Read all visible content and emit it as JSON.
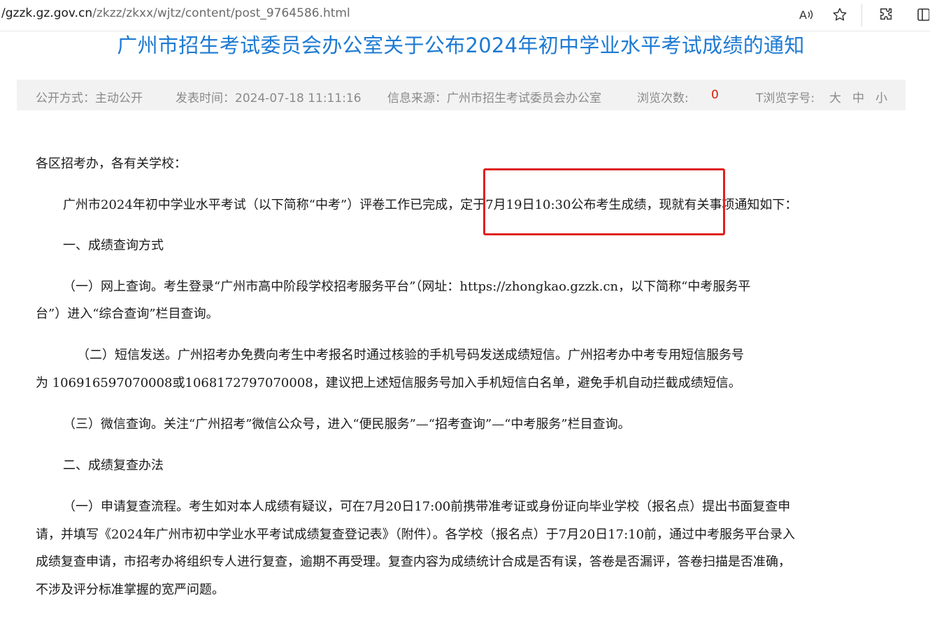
{
  "browser": {
    "url_host": "/gzzk.gz.gov.cn",
    "url_path": "/zkzz/zkxx/wjtz/content/post_9764586.html"
  },
  "article": {
    "title": "广州市招生考试委员会办公室关于公布2024年初中学业水平考试成绩的通知",
    "meta": {
      "disclosure": "公开方式：主动公开",
      "publish_time": "发表时间：2024-07-18 11:11:16",
      "source": "信息来源：广州市招生考试委员会办公室",
      "views_label": "浏览次数:",
      "views_count": "0",
      "font_size_label": "T浏览字号:",
      "size_large": "大",
      "size_medium": "中",
      "size_small": "小"
    },
    "paragraphs": {
      "p1": "各区招考办，各有关学校：",
      "p2": "广州市2024年初中学业水平考试（以下简称“中考”）评卷工作已完成，定于7月19日10:30公布考生成绩，现就有关事项通知如下：",
      "p3": "一、成绩查询方式",
      "p4a": "（一）网上查询。考生登录“广州市高中阶段学校招考服务平台”（网址：https://zhongkao.gzzk.cn，以下简称“中考服务平",
      "p4b": "台”）进入“综合查询”栏目查询。",
      "p5a": "（二）短信发送。广州招考办免费向考生中考报名时通过核验的手机号码发送成绩短信。广州招考办中考专用短信服务号",
      "p5b": "为  106916597070008或106817279707000​8，建议把上述短信服务号加入手机短信白名单，避免手机自动拦截成绩短信。",
      "p6": "（三）微信查询。关注“广州招考”微信公众号，进入“便民服务”—“招考查询”—“中考服务”栏目查询。",
      "p7": "二、成绩复查办法",
      "p8a": "（一）申请复查流程。考生如对本人成绩有疑议，可在7月20日17:00前携带准考证或身份证向毕业学校（报名点）提出书面复查申",
      "p8b": "请，并填写《2024年广州市初中学业水平考试成绩复查登记表》（附件）。各学校（报名点）于7月20日17:10前，通过中考服务平台录入",
      "p8c": "成绩复查申请，市招考办将组织专人进行复查，逾期不再受理。复查内容为成绩统计合成是否有误，答卷是否漏评，答卷扫描是否准确，",
      "p8d": "不涉及评分标准掌握的宽严问题。"
    }
  },
  "colors": {
    "title_blue": "#1d7ad3",
    "meta_gray": "#8a8a8a",
    "count_red": "#d81e06",
    "highlight_red": "#e02020"
  }
}
